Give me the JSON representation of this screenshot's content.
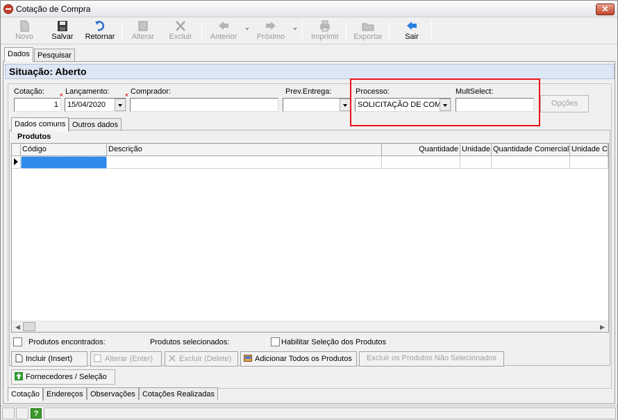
{
  "window": {
    "title": "Cotação de Compra",
    "close_label": "✕"
  },
  "toolbar": {
    "novo": "Novo",
    "salvar": "Salvar",
    "retornar": "Retornar",
    "alterar": "Alterar",
    "excluir": "Excluir",
    "anterior": "Anterior",
    "proximo": "Próximo",
    "imprimir": "Imprimir",
    "exportar": "Exportar",
    "sair": "Sair"
  },
  "top_tabs": {
    "dados": "Dados",
    "pesquisar": "Pesquisar"
  },
  "situacao": "Situação: Aberto",
  "form": {
    "cotacao_label": "Cotação:",
    "cotacao_value": "1",
    "lancamento_label": "Lançamento:",
    "lancamento_value": "15/04/2020",
    "comprador_label": "Comprador:",
    "comprador_value": "",
    "prev_entrega_label": "Prev.Entrega:",
    "prev_entrega_value": "",
    "processo_label": "Processo:",
    "processo_value": "SOLICITAÇÃO DE COM",
    "multselect_label": "MultSelect:",
    "multselect_value": "",
    "opcoes_label": "Opções",
    "required_mark": "*"
  },
  "sub_tabs": {
    "dados_comuns": "Dados comuns",
    "outros_dados": "Outros dados"
  },
  "produtos": {
    "group_label": "Produtos",
    "columns": [
      "Código",
      "Descrição",
      "Quantidade",
      "Unidade",
      "Quantidade Comercial",
      "Unidade Co"
    ]
  },
  "bottom": {
    "produtos_encontrados": "Produtos encontrados:",
    "produtos_selecionados": "Produtos selecionados:",
    "habilitar_selecao": "Habilitar Seleção dos Produtos",
    "incluir": "Incluir (Insert)",
    "alterar": "Alterar (Enter)",
    "excluir": "Excluir (Delete)",
    "adicionar_todos": "Adicionar Todos os Produtos",
    "excluir_nao_sel": "Excluir os Produtos Não Selecionados",
    "fornecedores": "Fornecedores / Seleção"
  },
  "bottom_tabs": {
    "cotacao": "Cotação",
    "enderecos": "Endereços",
    "observacoes": "Observações",
    "cotacoes_realizadas": "Cotações Realizadas"
  },
  "status": {
    "help": "?"
  }
}
